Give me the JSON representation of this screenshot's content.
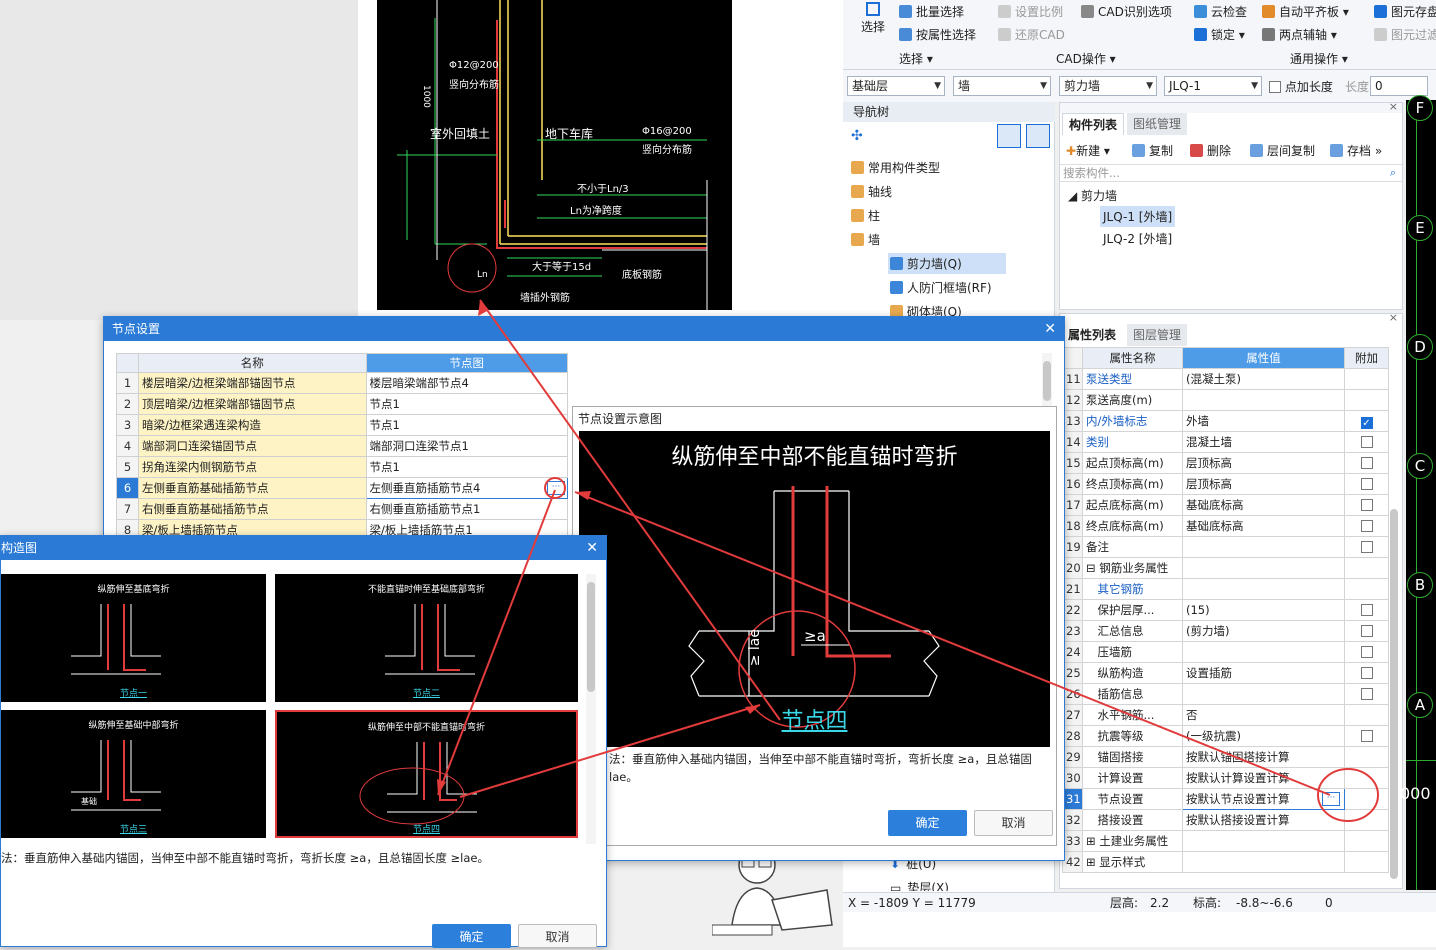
{
  "ribbon": {
    "select": "选择",
    "batch_select": "批量选择",
    "attr_select": "按属性选择",
    "select_group": "选择",
    "set_scale": "设置比例",
    "cad_identify": "CAD识别选项",
    "restore_cad": "还原CAD",
    "cad_group": "CAD操作",
    "cloud_check": "云检查",
    "auto_level": "自动平齐板",
    "lock": "锁定",
    "two_point": "两点辅轴",
    "common_group": "通用操作",
    "elem_save": "图元存盘",
    "elem_filter": "图元过滤"
  },
  "combos": {
    "floor": "基础层",
    "type": "墙",
    "sub": "剪力墙",
    "elem": "JLQ-1",
    "add_len": "点加长度",
    "len_label": "长度:",
    "len_val": "0"
  },
  "nav": {
    "title": "导航树",
    "items": [
      "常用构件类型",
      "轴线",
      "柱",
      "墙",
      "剪力墙(Q)",
      "人防门框墙(RF)",
      "砌体墙(Q)",
      "桩(U)",
      "垫层(X)"
    ]
  },
  "components": {
    "tab1": "构件列表",
    "tab2": "图纸管理",
    "new": "新建",
    "copy": "复制",
    "delete": "删除",
    "floor_copy": "层间复制",
    "save": "存档",
    "search_placeholder": "搜索构件...",
    "group": "剪力墙",
    "item1": "JLQ-1 [外墙]",
    "item2": "JLQ-2 [外墙]"
  },
  "props": {
    "tab1": "属性列表",
    "tab2": "图层管理",
    "col_name": "属性名称",
    "col_value": "属性值",
    "col_extra": "附加",
    "rows": [
      {
        "n": "11",
        "name": "泵送类型",
        "value": "(混凝土泵)",
        "blue": true,
        "cb": ""
      },
      {
        "n": "12",
        "name": "泵送高度(m)",
        "value": "",
        "blue": false,
        "cb": ""
      },
      {
        "n": "13",
        "name": "内/外墙标志",
        "value": "外墙",
        "blue": true,
        "cb": "on"
      },
      {
        "n": "14",
        "name": "类别",
        "value": "混凝土墙",
        "blue": true,
        "cb": "off"
      },
      {
        "n": "15",
        "name": "起点顶标高(m)",
        "value": "层顶标高",
        "blue": false,
        "cb": "off"
      },
      {
        "n": "16",
        "name": "终点顶标高(m)",
        "value": "层顶标高",
        "blue": false,
        "cb": "off"
      },
      {
        "n": "17",
        "name": "起点底标高(m)",
        "value": "基础底标高",
        "blue": false,
        "cb": "off"
      },
      {
        "n": "18",
        "name": "终点底标高(m)",
        "value": "基础底标高",
        "blue": false,
        "cb": "off"
      },
      {
        "n": "19",
        "name": "备注",
        "value": "",
        "blue": false,
        "cb": "off"
      },
      {
        "n": "20",
        "name": "⊟ 钢筋业务属性",
        "value": "",
        "blue": false,
        "cb": ""
      },
      {
        "n": "21",
        "name": "　其它钢筋",
        "value": "",
        "blue": true,
        "cb": ""
      },
      {
        "n": "22",
        "name": "　保护层厚...",
        "value": "(15)",
        "blue": false,
        "cb": "off"
      },
      {
        "n": "23",
        "name": "　汇总信息",
        "value": "(剪力墙)",
        "blue": false,
        "cb": "off"
      },
      {
        "n": "24",
        "name": "　压墙筋",
        "value": "",
        "blue": false,
        "cb": "off"
      },
      {
        "n": "25",
        "name": "　纵筋构造",
        "value": "设置插筋",
        "blue": false,
        "cb": "off"
      },
      {
        "n": "26",
        "name": "　插筋信息",
        "value": "",
        "blue": false,
        "cb": "off"
      },
      {
        "n": "27",
        "name": "　水平钢筋...",
        "value": "否",
        "blue": false,
        "cb": ""
      },
      {
        "n": "28",
        "name": "　抗震等级",
        "value": "(一级抗震)",
        "blue": false,
        "cb": "off"
      },
      {
        "n": "29",
        "name": "　锚固搭接",
        "value": "按默认锚固搭接计算",
        "blue": false,
        "cb": ""
      },
      {
        "n": "30",
        "name": "　计算设置",
        "value": "按默认计算设置计算",
        "blue": false,
        "cb": ""
      },
      {
        "n": "31",
        "name": "　节点设置",
        "value": "按默认节点设置计算",
        "blue": false,
        "cb": ""
      },
      {
        "n": "32",
        "name": "　搭接设置",
        "value": "按默认搭接设置计算",
        "blue": false,
        "cb": ""
      },
      {
        "n": "33",
        "name": "⊞ 土建业务属性",
        "value": "",
        "blue": false,
        "cb": ""
      },
      {
        "n": "42",
        "name": "⊞ 显示样式",
        "value": "",
        "blue": false,
        "cb": ""
      }
    ]
  },
  "status": {
    "coords": "X = -1809 Y = 11779",
    "floor_h_label": "层高:",
    "floor_h": "2.2",
    "elev_label": "标高:",
    "elev": "-8.8~-6.6",
    "zero": "0"
  },
  "axes": [
    "F",
    "E",
    "D",
    "C",
    "B",
    "A"
  ],
  "axis_num": "000",
  "cad_top": {
    "t1": "Φ12@200",
    "t2": "竖向分布筋",
    "t3": "1000",
    "t4": "室外回填土",
    "t5": "地下车库",
    "t6": "Φ16@200",
    "t7": "竖向分布筋",
    "t8": "不小于Ln/3",
    "t9": "Ln为净跨度",
    "t10": "大于等于15d",
    "t11": "底板钢筋",
    "t12": "墙插外钢筋",
    "t13": "Ln"
  },
  "node_dialog": {
    "title": "节点设置",
    "col_name": "名称",
    "col_img": "节点图",
    "rows": [
      {
        "n": "1",
        "name": "楼层暗梁/边框梁端部锚固节点",
        "val": "楼层暗梁端部节点4"
      },
      {
        "n": "2",
        "name": "顶层暗梁/边框梁端部锚固节点",
        "val": "节点1"
      },
      {
        "n": "3",
        "name": "暗梁/边框梁遇连梁构造",
        "val": "节点1"
      },
      {
        "n": "4",
        "name": "端部洞口连梁锚固节点",
        "val": "端部洞口连梁节点1"
      },
      {
        "n": "5",
        "name": "拐角连梁内侧钢筋节点",
        "val": "节点1"
      },
      {
        "n": "6",
        "name": "左侧垂直筋基础插筋节点",
        "val": "左侧垂直筋插筋节点4"
      },
      {
        "n": "7",
        "name": "右侧垂直筋基础插筋节点",
        "val": "右侧垂直筋插筋节点1"
      },
      {
        "n": "8",
        "name": "梁/板上墙插筋节点",
        "val": "梁/板上墙插筋节点1"
      }
    ],
    "ok": "确定",
    "cancel": "取消"
  },
  "schematic": {
    "title": "节点设置示意图",
    "heading": "纵筋伸至中部不能直锚时弯折",
    "ge_a": "≥a",
    "lae": "≥ lae",
    "node": "节点四",
    "desc": "法：垂直筋伸入基础内锚固，当伸至中部不能直锚时弯折，弯折长度 ≥a，且总锚固",
    "desc2": "lae。"
  },
  "structure": {
    "title": "构造图",
    "thumbs": [
      {
        "cap": "纵筋伸至基底弯折",
        "lbl": "节点一"
      },
      {
        "cap": "不能直锚时伸至基础底部弯折",
        "lbl": "节点二"
      },
      {
        "cap": "纵筋伸至基础中部弯折",
        "lbl": "节点三"
      },
      {
        "cap": "纵筋伸至中部不能直锚时弯折",
        "lbl": "节点四"
      }
    ],
    "base_label": "基础",
    "desc": "法：垂直筋伸入基础内锚固，当伸至中部不能直锚时弯折，弯折长度 ≥a，且总锚固长度 ≥lae。",
    "ok": "确定",
    "cancel": "取消"
  }
}
